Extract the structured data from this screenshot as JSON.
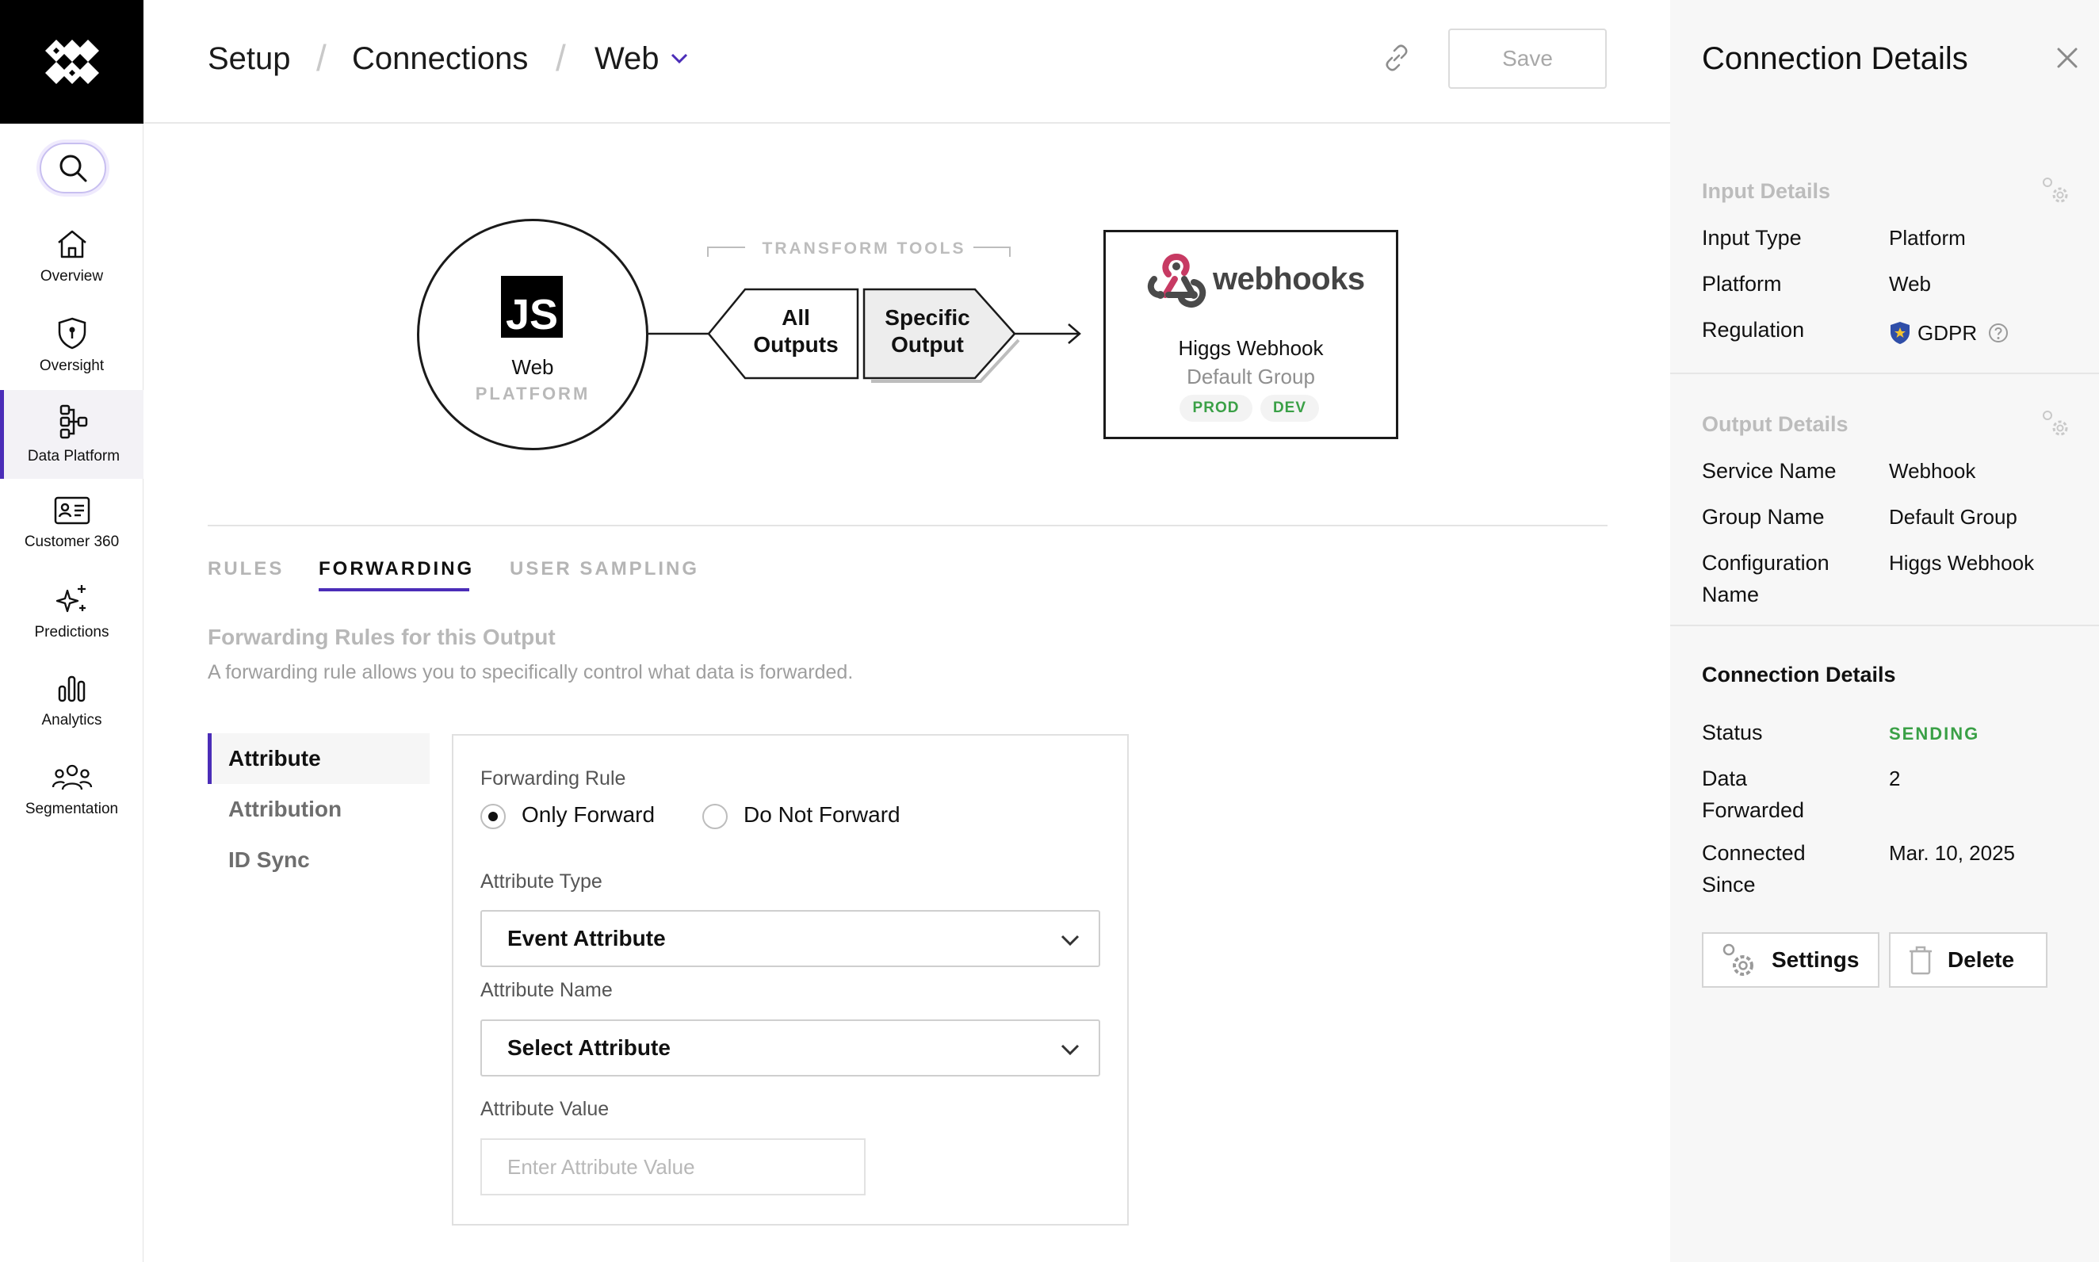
{
  "nav": {
    "items": [
      {
        "label": "Overview"
      },
      {
        "label": "Oversight"
      },
      {
        "label": "Data Platform"
      },
      {
        "label": "Customer 360"
      },
      {
        "label": "Predictions"
      },
      {
        "label": "Analytics"
      },
      {
        "label": "Segmentation"
      }
    ],
    "active": "Data Platform",
    "accent_color": "#4b2db8"
  },
  "breadcrumb": {
    "items": [
      "Setup",
      "Connections",
      "Web"
    ],
    "separator": "/"
  },
  "header": {
    "save_label": "Save"
  },
  "flow": {
    "input": {
      "logo_text": "JS",
      "name": "Web",
      "type": "PLATFORM"
    },
    "transform_tools_label": "TRANSFORM TOOLS",
    "tool_all": {
      "line1": "All",
      "line2": "Outputs"
    },
    "tool_specific": {
      "line1": "Specific",
      "line2": "Output"
    },
    "output": {
      "brand": "webhooks",
      "name": "Higgs Webhook",
      "group": "Default Group",
      "envs": [
        "PROD",
        "DEV"
      ]
    }
  },
  "tabs": [
    {
      "label": "RULES"
    },
    {
      "label": "FORWARDING"
    },
    {
      "label": "USER SAMPLING"
    }
  ],
  "active_tab": "FORWARDING",
  "forwarding": {
    "title": "Forwarding Rules for this Output",
    "description": "A forwarding rule allows you to specifically control what data is forwarded.",
    "submenu": [
      {
        "label": "Attribute"
      },
      {
        "label": "Attribution"
      },
      {
        "label": "ID Sync"
      }
    ],
    "active_submenu": "Attribute",
    "form": {
      "rule_label": "Forwarding Rule",
      "rule_options": [
        "Only Forward",
        "Do Not Forward"
      ],
      "rule_selected": "Only Forward",
      "attr_type_label": "Attribute Type",
      "attr_type_value": "Event Attribute",
      "attr_name_label": "Attribute Name",
      "attr_name_value": "Select Attribute",
      "attr_value_label": "Attribute Value",
      "attr_value_placeholder": "Enter Attribute Value",
      "attr_value_value": ""
    }
  },
  "drawer": {
    "title": "Connection Details",
    "input_details": {
      "title": "Input Details",
      "rows": [
        {
          "key": "Input Type",
          "value": "Platform"
        },
        {
          "key": "Platform",
          "value": "Web"
        },
        {
          "key": "Regulation",
          "value": "GDPR"
        }
      ]
    },
    "output_details": {
      "title": "Output Details",
      "rows": [
        {
          "key": "Service Name",
          "value": "Webhook"
        },
        {
          "key": "Group Name",
          "value": "Default Group"
        },
        {
          "key": "Configuration Name",
          "value": "Higgs Webhook"
        }
      ]
    },
    "connection_details": {
      "title": "Connection Details",
      "rows": [
        {
          "key": "Status",
          "value": "SENDING"
        },
        {
          "key": "Data Forwarded",
          "value": "2"
        },
        {
          "key": "Connected Since",
          "value": "Mar. 10, 2025"
        }
      ]
    },
    "settings_label": "Settings",
    "delete_label": "Delete",
    "status_color": "#3aa046"
  }
}
